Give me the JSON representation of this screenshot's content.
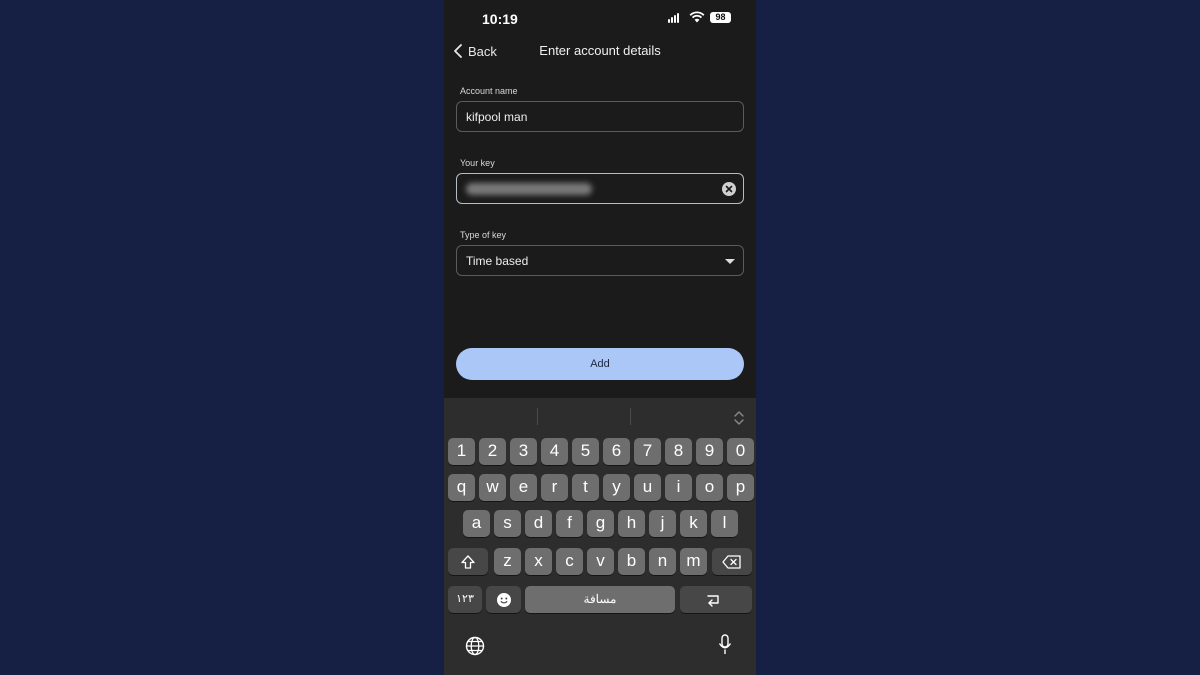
{
  "status_bar": {
    "time": "10:19",
    "battery": "98"
  },
  "header": {
    "back_label": "Back",
    "title": "Enter account details"
  },
  "form": {
    "account_name_label": "Account name",
    "account_name_value": "kifpool man",
    "key_label": "Your key",
    "type_label": "Type of key",
    "type_value": "Time based"
  },
  "add_button_label": "Add",
  "keyboard": {
    "row1": [
      "1",
      "2",
      "3",
      "4",
      "5",
      "6",
      "7",
      "8",
      "9",
      "0"
    ],
    "row2": [
      "q",
      "w",
      "e",
      "r",
      "t",
      "y",
      "u",
      "i",
      "o",
      "p"
    ],
    "row3": [
      "a",
      "s",
      "d",
      "f",
      "g",
      "h",
      "j",
      "k",
      "l"
    ],
    "row4": [
      "z",
      "x",
      "c",
      "v",
      "b",
      "n",
      "m"
    ],
    "numbers_key": "١٢٣",
    "space_label": "مسافة"
  },
  "colors": {
    "background": "#152044",
    "screen": "#1b1b1b",
    "accent_button": "#aac7f8",
    "keyboard": "#2d2d2d"
  }
}
